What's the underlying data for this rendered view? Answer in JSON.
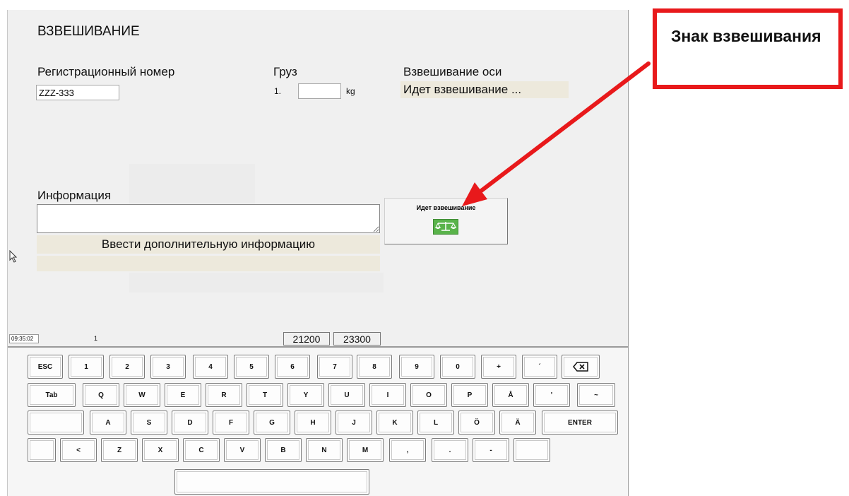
{
  "window": {
    "title": "ВЗВЕШИВАНИЕ"
  },
  "registration": {
    "label": "Регистрационный номер",
    "value": "ZZZ-333"
  },
  "load": {
    "label": "Груз",
    "row_number": "1.",
    "value": "",
    "unit": "kg"
  },
  "axle_weighing": {
    "label": "Взвешивание оси",
    "status": "Идет взвешивание ..."
  },
  "information": {
    "label": "Информация",
    "value": "",
    "hint": "Ввести дополнительную информацию"
  },
  "weighing_button": {
    "label": "Идет взвешивание",
    "icon": "scale-icon"
  },
  "status_bar": {
    "time": "09:35:02",
    "page": "1",
    "counter_1": "21200",
    "counter_2": "23300"
  },
  "keyboard": {
    "row1": [
      "ESC",
      "1",
      "2",
      "3",
      "4",
      "5",
      "6",
      "7",
      "8",
      "9",
      "0",
      "+",
      "´",
      "⌫"
    ],
    "row2": [
      "Tab",
      "Q",
      "W",
      "E",
      "R",
      "T",
      "Y",
      "U",
      "I",
      "O",
      "P",
      "Å",
      "'",
      "~"
    ],
    "row3": [
      "",
      "A",
      "S",
      "D",
      "F",
      "G",
      "H",
      "J",
      "K",
      "L",
      "Ö",
      "Ä",
      "ENTER"
    ],
    "row4": [
      "",
      "<",
      "Z",
      "X",
      "C",
      "V",
      "B",
      "N",
      "M",
      ",",
      ".",
      "-",
      ""
    ],
    "space": ""
  },
  "annotation": {
    "text": "Знак взвешивания",
    "color": "#e8191b"
  }
}
